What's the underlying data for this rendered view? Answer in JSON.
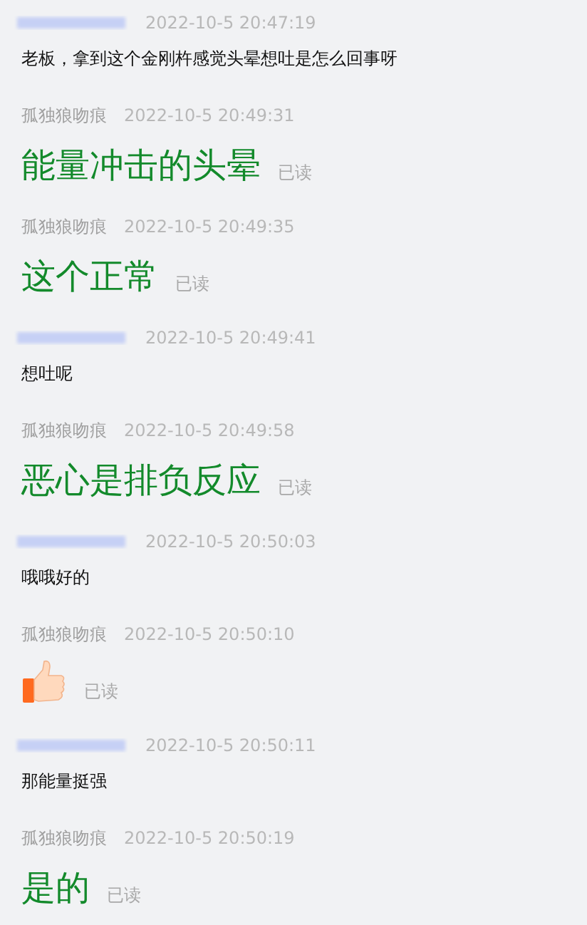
{
  "messages": [
    {
      "kind": "incoming",
      "time": "2022-10-5 20:47:19",
      "text": "老板，拿到这个金刚杵感觉头晕想吐是怎么回事呀"
    },
    {
      "kind": "outgoing",
      "sender": "孤独狼吻痕",
      "time": "2022-10-5 20:49:31",
      "text": "能量冲击的头晕",
      "status": "已读"
    },
    {
      "kind": "outgoing",
      "sender": "孤独狼吻痕",
      "time": "2022-10-5 20:49:35",
      "text": "这个正常",
      "status": "已读"
    },
    {
      "kind": "incoming",
      "time": "2022-10-5 20:49:41",
      "text": "想吐呢"
    },
    {
      "kind": "outgoing",
      "sender": "孤独狼吻痕",
      "time": "2022-10-5 20:49:58",
      "text": "恶心是排负反应",
      "status": "已读"
    },
    {
      "kind": "incoming",
      "time": "2022-10-5 20:50:03",
      "text": "哦哦好的"
    },
    {
      "kind": "outgoing_emoji",
      "sender": "孤独狼吻痕",
      "time": "2022-10-5 20:50:10",
      "status": "已读"
    },
    {
      "kind": "incoming",
      "time": "2022-10-5 20:50:11",
      "text": "那能量挺强"
    },
    {
      "kind": "outgoing",
      "sender": "孤独狼吻痕",
      "time": "2022-10-5 20:50:19",
      "text": "是的",
      "status": "已读"
    }
  ]
}
